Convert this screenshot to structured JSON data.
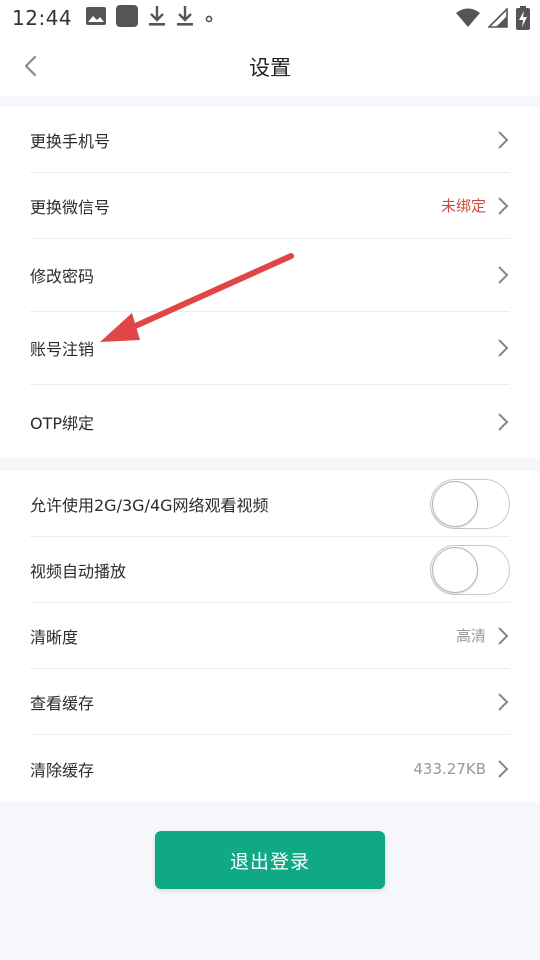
{
  "status_bar": {
    "time": "12:44",
    "left_icons": [
      "image-icon",
      "app-square-icon",
      "download-icon",
      "download-icon",
      "dot-icon"
    ],
    "right_icons": [
      "wifi-icon",
      "signal-icon",
      "battery-charging-icon"
    ]
  },
  "nav": {
    "title": "设置",
    "back_icon": "chevron-left-icon"
  },
  "account_section": [
    {
      "label": "更换手机号",
      "value": ""
    },
    {
      "label": "更换微信号",
      "value": "未绑定"
    },
    {
      "label": "修改密码",
      "value": ""
    },
    {
      "label": "账号注销",
      "value": ""
    },
    {
      "label": "OTP绑定",
      "value": ""
    }
  ],
  "video_section": [
    {
      "label": "允许使用2G/3G/4G网络观看视频",
      "toggle": false
    },
    {
      "label": "视频自动播放",
      "toggle": false
    },
    {
      "label": "清晰度",
      "value": "高清"
    },
    {
      "label": "查看缓存",
      "value": ""
    },
    {
      "label": "清除缓存",
      "value": "433.27KB"
    }
  ],
  "logout_label": "退出登录",
  "colors": {
    "accent_green": "#10a985",
    "warning_red": "#d0483c",
    "annotation_arrow": "#e04646"
  },
  "annotation": {
    "type": "arrow",
    "points_to": "账号注销"
  }
}
